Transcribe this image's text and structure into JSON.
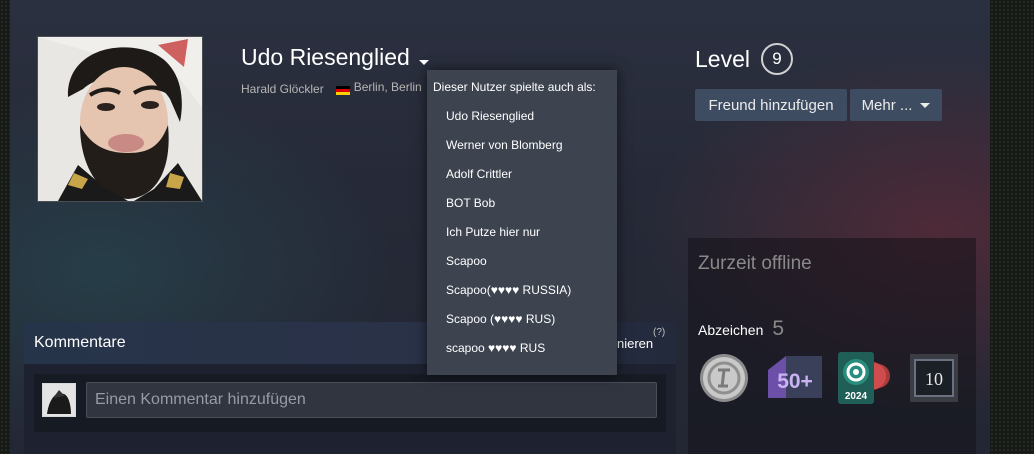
{
  "profile": {
    "persona_name": "Udo Riesenglied",
    "real_name": "Harald Glöckler",
    "location": "Berlin, Berlin",
    "level_label": "Level",
    "level": "9"
  },
  "actions": {
    "add_friend": "Freund hinzufügen",
    "more": "Mehr ..."
  },
  "alias_dropdown": {
    "header": "Dieser Nutzer spielte auch als:",
    "items": [
      "Udo Riesenglied",
      "Werner von Blomberg",
      "Adolf Crittler",
      "BOT Bob",
      "Ich Putze hier nur",
      "Scapoo",
      "Scapoo(♥♥♥♥ RUSSIA)",
      "Scapoo (♥♥♥♥ RUS)",
      "scapoo ♥♥♥♥ RUS"
    ]
  },
  "status": {
    "text": "Zurzeit offline",
    "badges_label": "Abzeichen",
    "badges_count": "5",
    "badges": [
      {
        "icon": "silver-coin-badge-icon"
      },
      {
        "icon": "fifty-plus-badge-icon",
        "text": "50+"
      },
      {
        "icon": "steam-2024-badge-icon",
        "text": "2024"
      },
      {
        "icon": "years-of-service-badge-icon",
        "text": "10"
      }
    ]
  },
  "comments": {
    "title": "Kommentare",
    "subscribe_partial": "nieren",
    "help": "(?)",
    "input_placeholder": "Einen Kommentar hinzufügen"
  },
  "colors": {
    "button_bg": "#3d4c61",
    "dropdown_bg": "#3d4450",
    "panel_bg": "#1e2230"
  }
}
